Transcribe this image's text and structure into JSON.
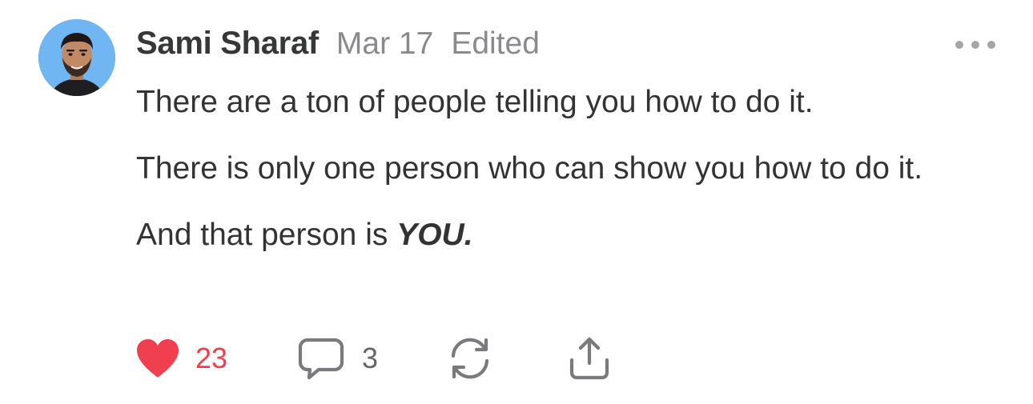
{
  "post": {
    "author": "Sami Sharaf",
    "date": "Mar 17",
    "edited_label": "Edited",
    "paragraphs": [
      "There are a ton of people telling you how to do it.",
      "There is only one person who can show you how to do it."
    ],
    "last_line_prefix": "And that person is ",
    "last_line_emphasis": "YOU."
  },
  "actions": {
    "likes": "23",
    "comments": "3"
  },
  "colors": {
    "like": "#f0404f",
    "muted": "#8a8a8e",
    "avatar_bg": "#6fb6f2"
  },
  "icons": {
    "more": "more-horizontal-icon",
    "like": "heart-filled-icon",
    "comment": "speech-bubble-icon",
    "restack": "refresh-cycle-icon",
    "share": "share-upload-icon"
  }
}
